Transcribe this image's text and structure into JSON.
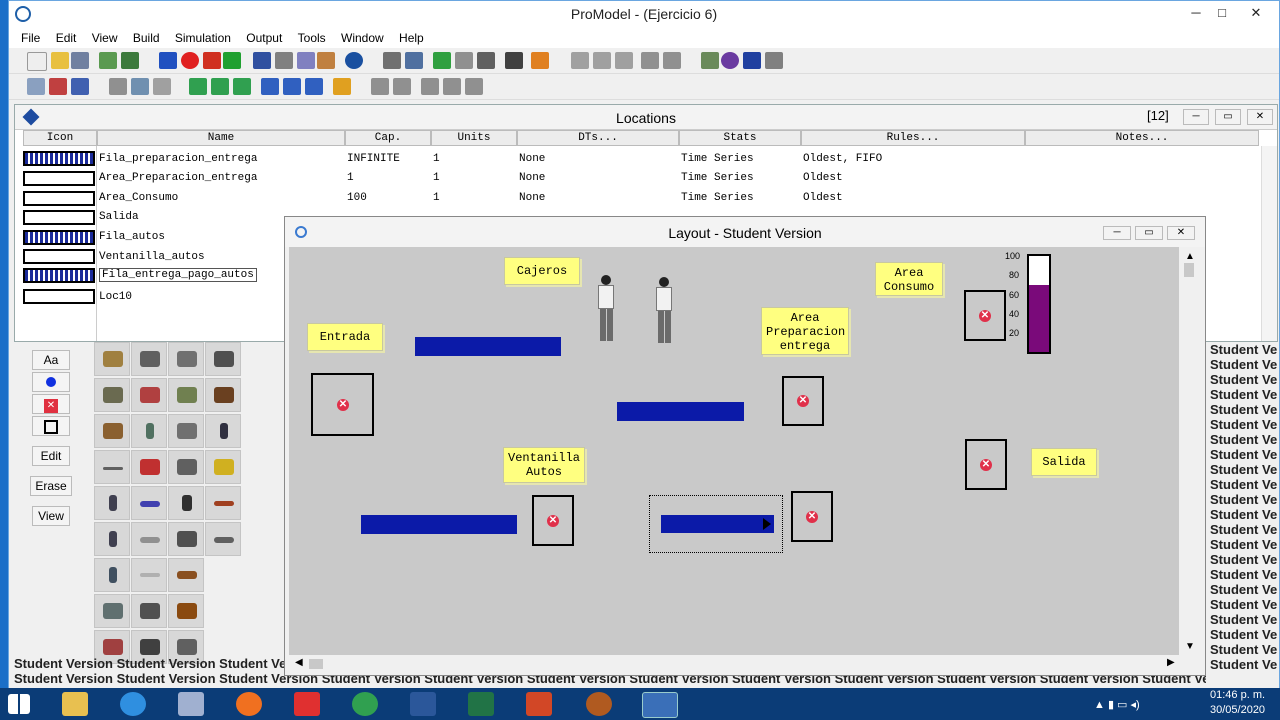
{
  "app": {
    "title": "ProModel -  (Ejercicio 6)",
    "menu": [
      "File",
      "Edit",
      "View",
      "Build",
      "Simulation",
      "Output",
      "Tools",
      "Window",
      "Help"
    ]
  },
  "locations": {
    "title": "Locations",
    "count": "[12]",
    "columns": [
      "Icon",
      "Name",
      "Cap.",
      "Units",
      "DTs...",
      "Stats",
      "Rules...",
      "Notes..."
    ],
    "rows": [
      {
        "name": "Fila_preparacion_entrega",
        "cap": "INFINITE",
        "units": "1",
        "dts": "None",
        "stats": "Time Series",
        "rules": "Oldest, FIFO",
        "queue": true
      },
      {
        "name": "Area_Preparacion_entrega",
        "cap": "1",
        "units": "1",
        "dts": "None",
        "stats": "Time Series",
        "rules": "Oldest",
        "queue": false
      },
      {
        "name": "Area_Consumo",
        "cap": "100",
        "units": "1",
        "dts": "None",
        "stats": "Time Series",
        "rules": "Oldest",
        "queue": false
      },
      {
        "name": "Salida",
        "cap": "1",
        "units": "1",
        "dts": "None",
        "stats": "Time Series",
        "rules": "Oldest",
        "queue": false
      },
      {
        "name": "Fila_autos",
        "cap": "",
        "units": "",
        "dts": "",
        "stats": "",
        "rules": "",
        "queue": true
      },
      {
        "name": "Ventanilla_autos",
        "cap": "",
        "units": "",
        "dts": "",
        "stats": "",
        "rules": "",
        "queue": false
      },
      {
        "name": "Fila_entrega_pago_autos",
        "cap": "",
        "units": "",
        "dts": "",
        "stats": "",
        "rules": "",
        "queue": true
      },
      {
        "name": "Loc10",
        "cap": "",
        "units": "",
        "dts": "",
        "stats": "",
        "rules": "",
        "queue": false
      }
    ]
  },
  "graphics": {
    "buttons": {
      "text": "Aa",
      "edit": "Edit",
      "erase": "Erase",
      "view": "View"
    }
  },
  "layout": {
    "title": "Layout - Student Version",
    "labels": {
      "cajeros": "Cajeros",
      "entrada": "Entrada",
      "area_consumo_1": "Area",
      "area_consumo_2": "Consumo",
      "area_prep_1": "Area",
      "area_prep_2": "Preparacion",
      "area_prep_3": "entrega",
      "ventanilla_1": "Ventanilla",
      "ventanilla_2": "Autos",
      "salida": "Salida"
    },
    "gauge": {
      "ticks": [
        "100",
        "80",
        "60",
        "40",
        "20"
      ],
      "level_fraction": 0.7,
      "fill_color": "#7a0a7a"
    }
  },
  "watermark": "Student Version Student Version Student Version Student Version Student Version Student Version Student Version Student Version Student Version Student Version Student Version Student Version",
  "watermark_short": "Student Ve",
  "taskbar": {
    "time": "01:46 p. m.",
    "date": "30/05/2020"
  }
}
